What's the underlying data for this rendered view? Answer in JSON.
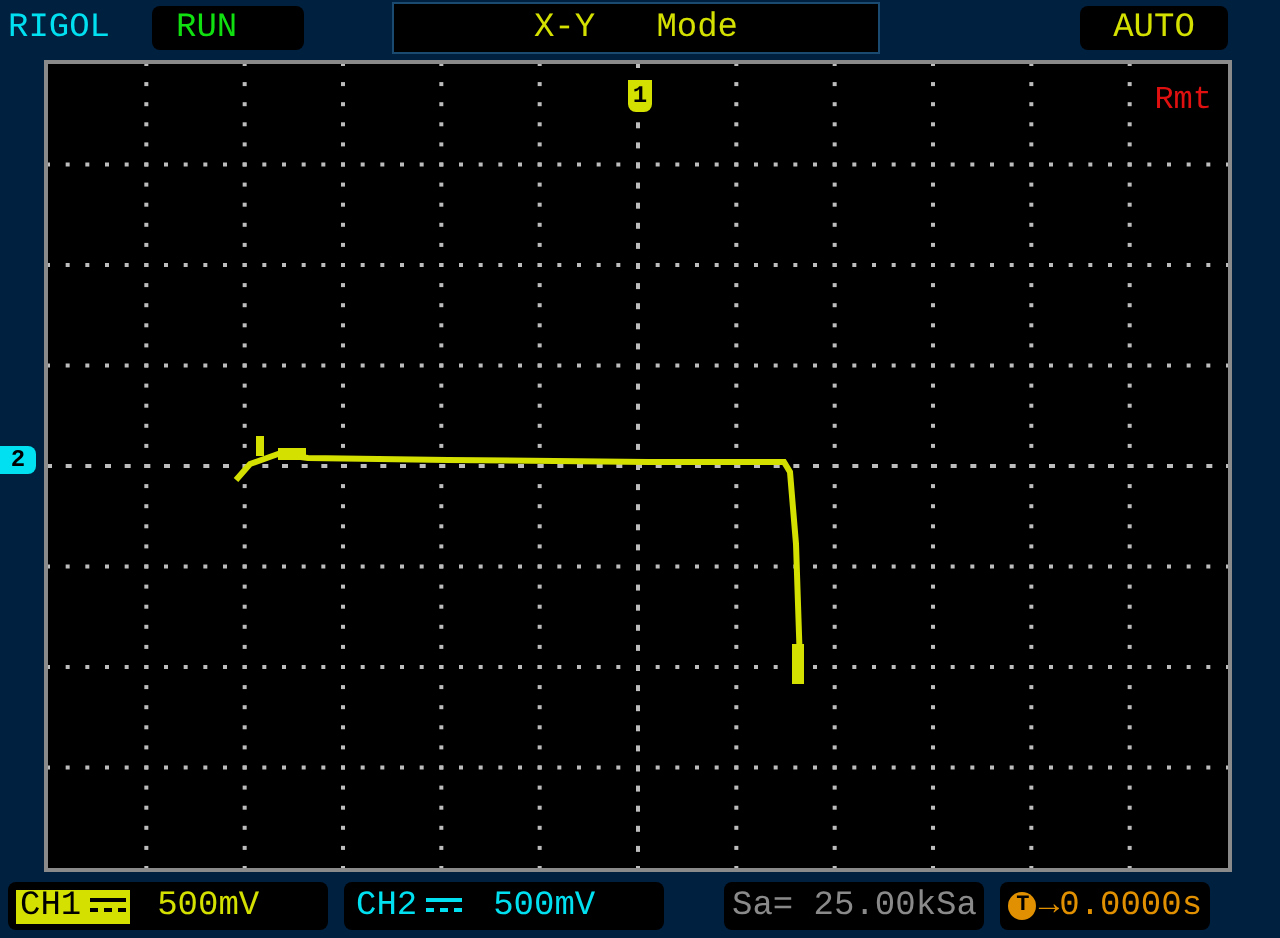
{
  "header": {
    "brand": "RIGOL",
    "run_state": "RUN",
    "mode": "X-Y   Mode",
    "trigger_mode": "AUTO"
  },
  "screen": {
    "ch1_marker": "1",
    "ch2_marker": "2",
    "remote": "Rmt"
  },
  "footer": {
    "channels": [
      {
        "name": "CH1",
        "scale": "500mV",
        "selected": true
      },
      {
        "name": "CH2",
        "scale": "500mV",
        "selected": false
      }
    ],
    "sample_rate": "Sa= 25.00kSa",
    "trigger_marker": "T",
    "trigger_offset": "→0.0000s"
  }
}
